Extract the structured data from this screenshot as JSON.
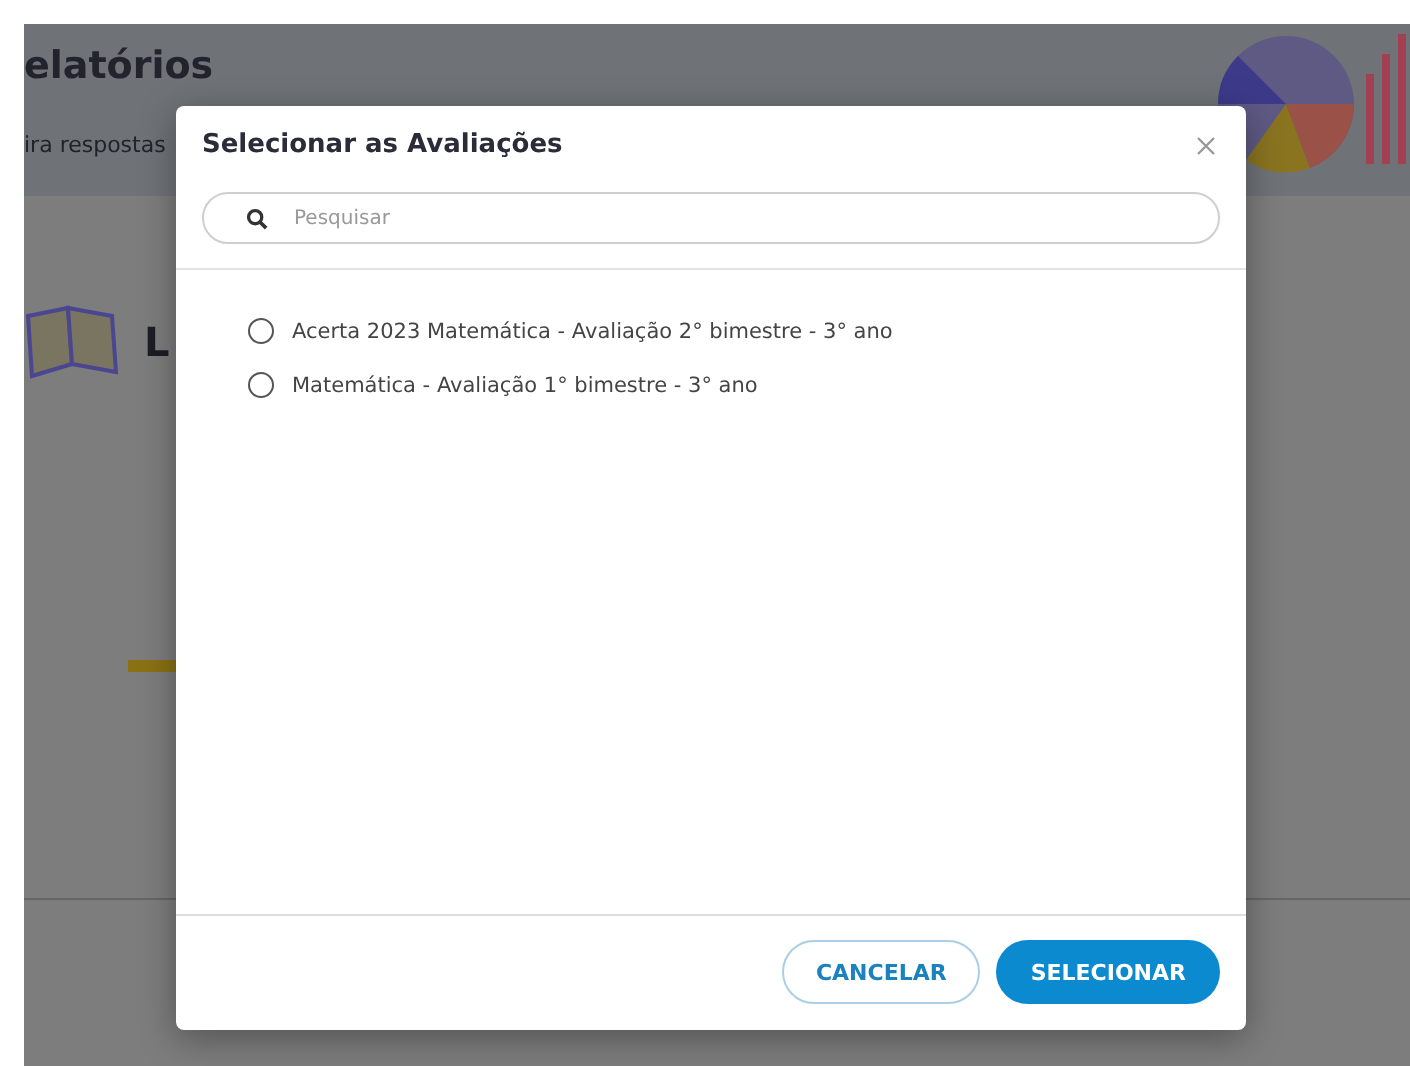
{
  "background": {
    "title": "elatórios",
    "subtitle": "ira respostas",
    "section_heading": "L"
  },
  "dialog": {
    "title": "Selecionar as Avaliações",
    "search": {
      "placeholder": "Pesquisar"
    },
    "options": [
      {
        "label": "Acerta 2023 Matemática - Avaliação 2° bimestre - 3° ano",
        "selected": false
      },
      {
        "label": "Matemática - Avaliação 1° bimestre - 3° ano",
        "selected": false
      }
    ],
    "buttons": [
      {
        "label": "CANCELAR",
        "kind": "secondary"
      },
      {
        "label": "SELECIONAR",
        "kind": "primary"
      }
    ]
  }
}
